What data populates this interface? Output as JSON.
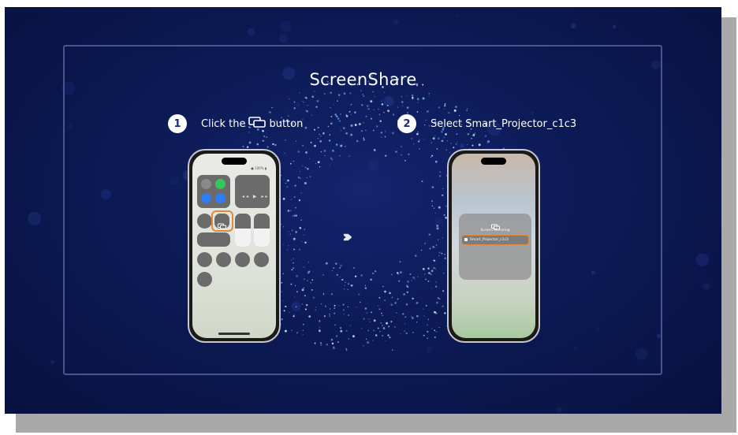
{
  "app": {
    "title": "ScreenShare"
  },
  "steps": [
    {
      "number": "1",
      "text_before": "Click the",
      "icon": "screen-mirror-icon",
      "text_after": "button"
    },
    {
      "number": "2",
      "text": "Select Smart_Projector_c1c3"
    }
  ],
  "phone1": {
    "status_right": "● 100% ▮"
  },
  "phone2": {
    "panel_title": "Screen Mirroring",
    "device_name": "Smart_Projector_c1c3"
  },
  "transition": {
    "arrows": "›››››"
  },
  "colors": {
    "background": "#0c1a55",
    "highlight": "#e08a3c",
    "badge": "#ffffff",
    "toggle_green": "#34c759",
    "toggle_blue": "#2f7cf6"
  }
}
